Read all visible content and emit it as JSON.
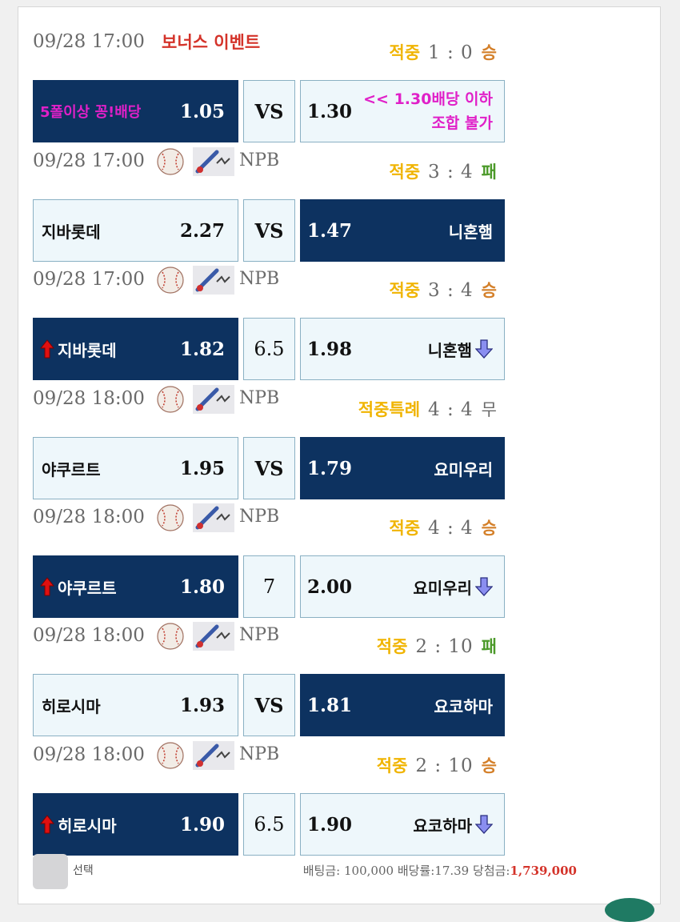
{
  "colors": {
    "win": "#d4802a",
    "lose": "#4c9a2a",
    "draw": "#6a6a6a",
    "hit_label": "#f0b400",
    "dark_cell": "#0d3260",
    "light_cell": "#eef7fb",
    "promo": "#e020c8",
    "event": "#d4332a"
  },
  "games": [
    {
      "datetime": "09/28 17:00",
      "event_label": "보너스 이벤트",
      "league": "",
      "result_label": "적중",
      "score": "1 : 0",
      "outcome": "승",
      "outcome_type": "win",
      "home": {
        "name": "5폴이상 꽁!배당",
        "odd": "1.05",
        "selected": true,
        "arrow": false,
        "promo": true
      },
      "middle": "VS",
      "away": {
        "name": "<< 1.30배당 이하 조합 불가",
        "name_line1": "<< 1.30배당 이하",
        "name_line2": "조합 불가",
        "odd": "1.30",
        "selected": false,
        "arrow": false,
        "promo": true
      }
    },
    {
      "datetime": "09/28 17:00",
      "league": "NPB",
      "league_icons": [
        "baseball-icon",
        "bat-icon"
      ],
      "result_label": "적중",
      "score": "3 : 4",
      "outcome": "패",
      "outcome_type": "lose",
      "home": {
        "name": "지바롯데",
        "odd": "2.27",
        "selected": false,
        "arrow": false
      },
      "middle": "VS",
      "away": {
        "name": "니혼햄",
        "odd": "1.47",
        "selected": true,
        "arrow": false
      }
    },
    {
      "datetime": "09/28 17:00",
      "league": "NPB",
      "league_icons": [
        "baseball-icon",
        "bat-icon"
      ],
      "result_label": "적중",
      "score": "3 : 4",
      "outcome": "승",
      "outcome_type": "win",
      "home": {
        "name": "지바롯데",
        "odd": "1.82",
        "selected": true,
        "arrow": true
      },
      "middle": "6.5",
      "away": {
        "name": "니혼햄",
        "odd": "1.98",
        "selected": false,
        "arrow": true
      }
    },
    {
      "datetime": "09/28 18:00",
      "league": "NPB",
      "league_icons": [
        "baseball-icon",
        "bat-icon"
      ],
      "result_label": "적중특례",
      "score": "4 : 4",
      "outcome": "무",
      "outcome_type": "draw",
      "home": {
        "name": "야쿠르트",
        "odd": "1.95",
        "selected": false,
        "arrow": false
      },
      "middle": "VS",
      "away": {
        "name": "요미우리",
        "odd": "1.79",
        "selected": true,
        "arrow": false
      }
    },
    {
      "datetime": "09/28 18:00",
      "league": "NPB",
      "league_icons": [
        "baseball-icon",
        "bat-icon"
      ],
      "result_label": "적중",
      "score": "4 : 4",
      "outcome": "승",
      "outcome_type": "win",
      "home": {
        "name": "야쿠르트",
        "odd": "1.80",
        "selected": true,
        "arrow": true
      },
      "middle": "7",
      "away": {
        "name": "요미우리",
        "odd": "2.00",
        "selected": false,
        "arrow": true
      }
    },
    {
      "datetime": "09/28 18:00",
      "league": "NPB",
      "league_icons": [
        "baseball-icon",
        "bat-icon"
      ],
      "result_label": "적중",
      "score": "2 : 10",
      "outcome": "패",
      "outcome_type": "lose",
      "home": {
        "name": "히로시마",
        "odd": "1.93",
        "selected": false,
        "arrow": false
      },
      "middle": "VS",
      "away": {
        "name": "요코하마",
        "odd": "1.81",
        "selected": true,
        "arrow": false
      }
    },
    {
      "datetime": "09/28 18:00",
      "league": "NPB",
      "league_icons": [
        "baseball-icon",
        "bat-icon"
      ],
      "result_label": "적중",
      "score": "2 : 10",
      "outcome": "승",
      "outcome_type": "win",
      "home": {
        "name": "히로시마",
        "odd": "1.90",
        "selected": true,
        "arrow": true
      },
      "middle": "6.5",
      "away": {
        "name": "요코하마",
        "odd": "1.90",
        "selected": false,
        "arrow": true
      }
    }
  ],
  "footer": {
    "select_label": "선택",
    "bet_amount_label": "배팅금:",
    "bet_amount": "100,000",
    "odds_label": "배당률:",
    "odds": "17.39",
    "winnings_label": "당첨금:",
    "winnings": "1,739,000"
  }
}
